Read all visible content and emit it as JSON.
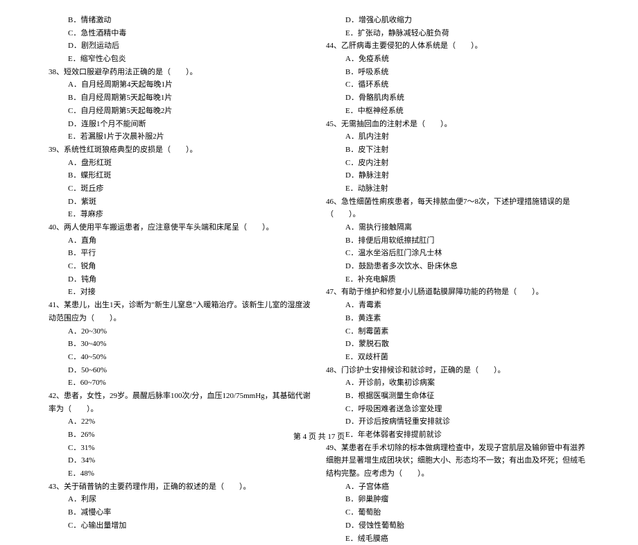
{
  "left": {
    "pre_options": [
      "B．情绪激动",
      "C．急性酒精中毒",
      "D．剧烈运动后",
      "E．缩窄性心包炎"
    ],
    "q38": {
      "text": "38、短效口服避孕药用法正确的是（　　）。",
      "options": [
        "A．自月经周期第4天起每晚1片",
        "B．自月经周期第5天起每晚1片",
        "C．自月经周期第5天起每晚2片",
        "D．连服1个月不能间断",
        "E．若漏服1片于次晨补服2片"
      ]
    },
    "q39": {
      "text": "39、系统性红斑狼疮典型的皮损是（　　）。",
      "options": [
        "A．盘形红斑",
        "B．蝶形红斑",
        "C．斑丘疹",
        "D．紫斑",
        "E．荨麻疹"
      ]
    },
    "q40": {
      "text": "40、两人使用平车搬运患者，应注意使平车头端和床尾呈（　　）。",
      "options": [
        "A．直角",
        "B．平行",
        "C．锐角",
        "D．钝角",
        "E．对接"
      ]
    },
    "q41": {
      "text": "41、某患儿，出生1天，诊断为\"新生儿窒息\"入暖箱治疗。该新生儿室的湿度波动范围应为（　　）。",
      "options": [
        "A．20~30%",
        "B．30~40%",
        "C．40~50%",
        "D．50~60%",
        "E．60~70%"
      ]
    },
    "q42": {
      "text": "42、患者，女性，29岁。晨醒后脉率100次/分，血压120/75mmHg，其基础代谢率为（　　）。",
      "options": [
        "A．22%",
        "B．26%",
        "C．31%",
        "D．34%",
        "E．48%"
      ]
    },
    "q43": {
      "text": "43、关于硝普钠的主要药理作用，正确的叙述的是（　　）。",
      "options": [
        "A．利尿",
        "B．减慢心率",
        "C．心输出量增加"
      ]
    }
  },
  "right": {
    "pre_options": [
      "D．增强心肌收缩力",
      "E．扩张动，静脉减轻心脏负荷"
    ],
    "q44": {
      "text": "44、乙肝病毒主要侵犯的人体系统是（　　）。",
      "options": [
        "A．免疫系统",
        "B．呼吸系统",
        "C．循环系统",
        "D．骨骼肌肉系统",
        "E．中枢神经系统"
      ]
    },
    "q45": {
      "text": "45、无需抽回血的注射术是（　　）。",
      "options": [
        "A．肌内注射",
        "B．皮下注射",
        "C．皮内注射",
        "D．静脉注射",
        "E．动脉注射"
      ]
    },
    "q46": {
      "text": "46、急性细菌性痢疾患者，每天排脓血便7～8次，下述护理措施错误的是（　　）。",
      "options": [
        "A．需执行接触隔离",
        "B．排便后用软纸擦拭肛门",
        "C．温水坐浴后肛门涂凡士林",
        "D．鼓励患者多次饮水、卧床休息",
        "E．补充电解质"
      ]
    },
    "q47": {
      "text": "47、有助于维护和修复小儿肠道黏膜屏障功能的药物是（　　）。",
      "options": [
        "A．青霉素",
        "B．黄连素",
        "C．制霉菌素",
        "D．蒙脱石散",
        "E．双歧杆菌"
      ]
    },
    "q48": {
      "text": "48、门诊护士安排候诊和就诊时，正确的是（　　）。",
      "options": [
        "A．开诊前，收集初诊病案",
        "B．根据医嘱测量生命体征",
        "C．呼吸困难者送急诊室处理",
        "D．开诊后按病情轻重安排就诊",
        "E．年老体弱者安排提前就诊"
      ]
    },
    "q49": {
      "text": "49、某患者在手术切除的标本做病理检查中，发现子宫肌层及输卵管中有滋养细胞并显著增生成团块状；细胞大小、形态均不一致；有出血及坏死；但绒毛结构完整。应考虑为（　　）。",
      "options": [
        "A．子宫体癌",
        "B．卵巢肿瘤",
        "C．葡萄胎",
        "D．侵蚀性葡萄胎",
        "E．绒毛膜癌"
      ]
    }
  },
  "footer": "第 4 页 共 17 页"
}
